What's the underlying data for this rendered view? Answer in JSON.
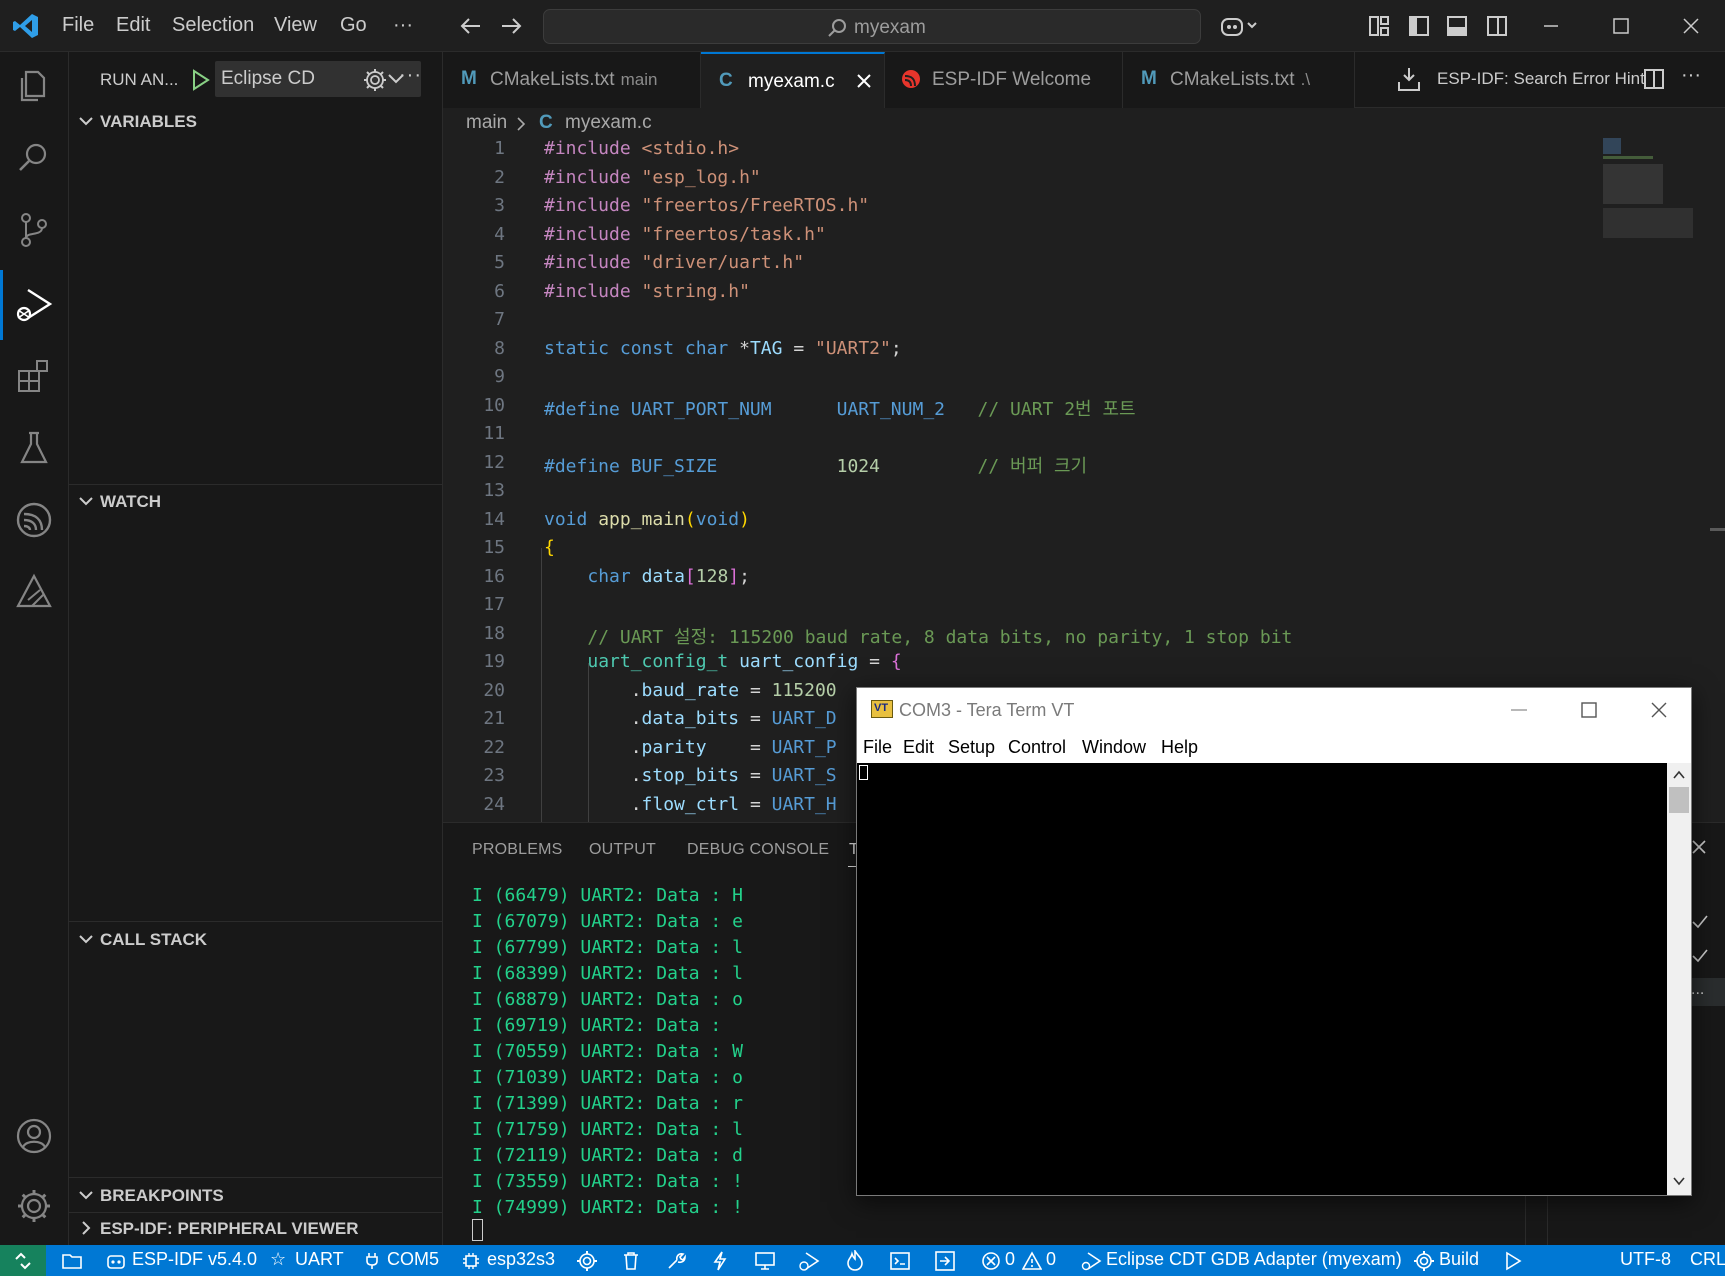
{
  "titlebar": {
    "menus": [
      "File",
      "Edit",
      "Selection",
      "View",
      "Go",
      "···"
    ],
    "search": "myexam"
  },
  "sidebar": {
    "run_label": "RUN AN...",
    "config": "Eclipse CD",
    "sections": [
      "VARIABLES",
      "WATCH",
      "CALL STACK",
      "BREAKPOINTS",
      "ESP-IDF: PERIPHERAL VIEWER"
    ]
  },
  "tabs": [
    {
      "icon": "M",
      "label": "CMakeLists.txt",
      "desc": "main"
    },
    {
      "icon": "C",
      "label": "myexam.c",
      "desc": ""
    },
    {
      "icon": "",
      "label": "ESP-IDF Welcome",
      "desc": ""
    },
    {
      "icon": "M",
      "label": "CMakeLists.txt",
      "desc": ".\\"
    }
  ],
  "tabbar_right": "ESP-IDF: Search Error Hint",
  "breadcrumb": {
    "folder": "main",
    "icon": "C",
    "file": "myexam.c"
  },
  "editor": {
    "line_numbers": [
      "1",
      "2",
      "3",
      "4",
      "5",
      "6",
      "7",
      "8",
      "9",
      "10",
      "11",
      "12",
      "13",
      "14",
      "15",
      "16",
      "17",
      "18",
      "19",
      "20",
      "21",
      "22",
      "23",
      "24"
    ]
  },
  "panel": {
    "tabs": [
      "PROBLEMS",
      "OUTPUT",
      "DEBUG CONSOLE",
      "T"
    ],
    "terminal_lines": [
      "I (66479) UART2: Data : H",
      "I (67079) UART2: Data : e",
      "I (67799) UART2: Data : l",
      "I (68399) UART2: Data : l",
      "I (68879) UART2: Data : o",
      "I (69719) UART2: Data :",
      "I (70559) UART2: Data : W",
      "I (71039) UART2: Data : o",
      "I (71399) UART2: Data : r",
      "I (71759) UART2: Data : l",
      "I (72119) UART2: Data : d",
      "I (73559) UART2: Data : !",
      "I (74999) UART2: Data : !"
    ]
  },
  "teraterm": {
    "title": "COM3 - Tera Term VT",
    "logo": "VT",
    "menus": [
      "File",
      "Edit",
      "Setup",
      "Control",
      "Window",
      "Help"
    ]
  },
  "statusbar": {
    "idf": "ESP-IDF v5.4.0",
    "uart": "UART",
    "port": "COM5",
    "target": "esp32s3",
    "errors": "0",
    "warnings": "0",
    "debug": "Eclipse CDT GDB Adapter (myexam)",
    "build": "Build",
    "encoding": "UTF-8",
    "eol": "CRL"
  },
  "colors": {
    "accent": "#0078d4",
    "terminal_green": "#23d18b",
    "editor_bg": "#1f1f1f"
  }
}
